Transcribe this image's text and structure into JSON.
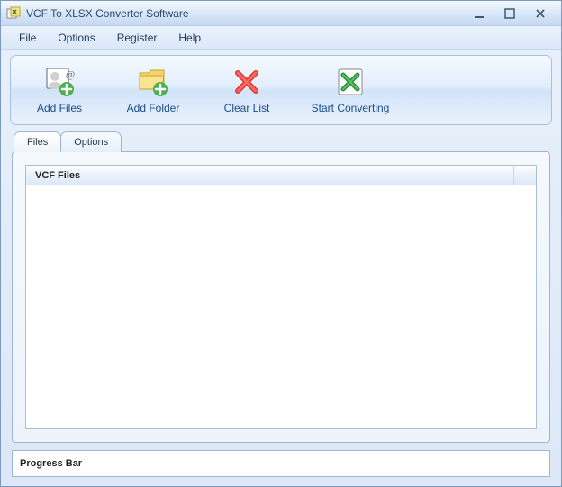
{
  "titlebar": {
    "title": "VCF To XLSX Converter Software"
  },
  "menu": {
    "items": [
      "File",
      "Options",
      "Register",
      "Help"
    ]
  },
  "toolbar": {
    "add_files": "Add Files",
    "add_folder": "Add Folder",
    "clear_list": "Clear List",
    "start_converting": "Start Converting"
  },
  "tabs": {
    "files": "Files",
    "options": "Options",
    "active": "files"
  },
  "list": {
    "column_header": "VCF Files"
  },
  "progress": {
    "label": "Progress Bar"
  }
}
